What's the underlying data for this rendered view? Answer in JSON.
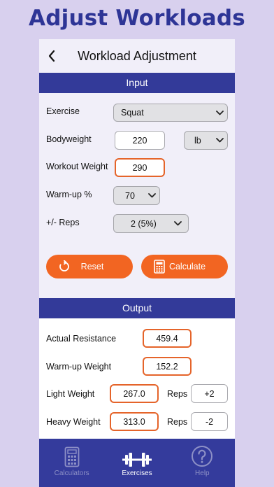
{
  "promo_title": "Adjust Workloads",
  "header": {
    "title": "Workload Adjustment"
  },
  "input": {
    "section_title": "Input",
    "exercise": {
      "label": "Exercise",
      "value": "Squat"
    },
    "bodyweight": {
      "label": "Bodyweight",
      "value": "220",
      "unit": "lb"
    },
    "workout_weight": {
      "label": "Workout Weight",
      "value": "290"
    },
    "warmup_pct": {
      "label": "Warm-up %",
      "value": "70"
    },
    "reps": {
      "label": "+/- Reps",
      "value": "2 (5%)"
    },
    "reset_label": "Reset",
    "calculate_label": "Calculate"
  },
  "output": {
    "section_title": "Output",
    "actual_resistance": {
      "label": "Actual Resistance",
      "value": "459.4"
    },
    "warmup_weight": {
      "label": "Warm-up Weight",
      "value": "152.2"
    },
    "light_weight": {
      "label": "Light Weight",
      "value": "267.0",
      "reps_label": "Reps",
      "reps_value": "+2"
    },
    "heavy_weight": {
      "label": "Heavy Weight",
      "value": "313.0",
      "reps_label": "Reps",
      "reps_value": "-2"
    }
  },
  "tabs": [
    {
      "label": "Calculators",
      "icon": "calculator-icon",
      "active": false
    },
    {
      "label": "Exercises",
      "icon": "barbell-icon",
      "active": true
    },
    {
      "label": "Help",
      "icon": "help-icon",
      "active": false
    }
  ],
  "colors": {
    "brand": "#333a99",
    "accent": "#f26522",
    "panel": "#f1eff9",
    "background": "#d8d0ee"
  }
}
